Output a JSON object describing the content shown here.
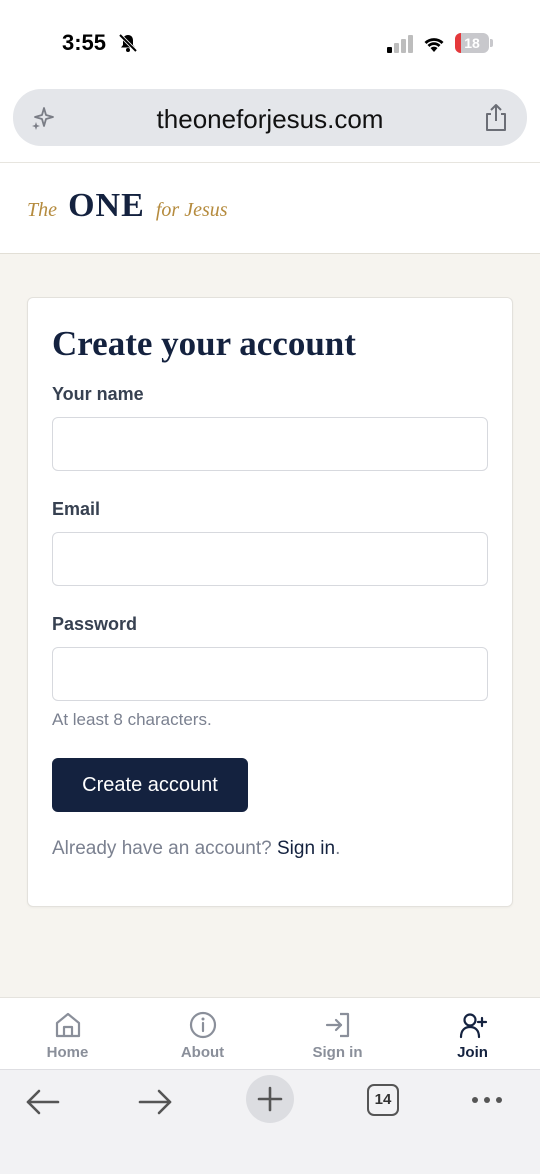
{
  "status_bar": {
    "time": "3:55",
    "battery_level": "18",
    "battery_fraction": 0.18,
    "icons": [
      "bell-muted-icon",
      "cell-signal-icon",
      "wifi-icon",
      "battery-icon"
    ]
  },
  "browser": {
    "url": "theoneforjesus.com",
    "icons": [
      "sparkle-icon",
      "share-icon"
    ],
    "toolbar": {
      "tab_count": "14",
      "icons": [
        "back-arrow-icon",
        "forward-arrow-icon",
        "new-tab-plus-icon",
        "tabs-icon",
        "more-icon"
      ]
    }
  },
  "site": {
    "logo": {
      "the": "The",
      "one": "ONE",
      "for_jesus": "for Jesus"
    },
    "colors": {
      "navy": "#14223f",
      "gold": "#b58b3e",
      "page_bg": "#f6f4ef"
    }
  },
  "form": {
    "title": "Create your account",
    "name_label": "Your name",
    "name_value": "",
    "email_label": "Email",
    "email_value": "",
    "password_label": "Password",
    "password_value": "",
    "password_hint": "At least 8 characters.",
    "submit_label": "Create account",
    "signin_prompt": "Already have an account?",
    "signin_link": "Sign in",
    "signin_period": "."
  },
  "bottom_nav": {
    "items": [
      {
        "label": "Home",
        "icon": "home-icon"
      },
      {
        "label": "About",
        "icon": "info-icon"
      },
      {
        "label": "Sign in",
        "icon": "sign-in-icon"
      },
      {
        "label": "Join",
        "icon": "add-user-icon",
        "active": true
      }
    ]
  }
}
